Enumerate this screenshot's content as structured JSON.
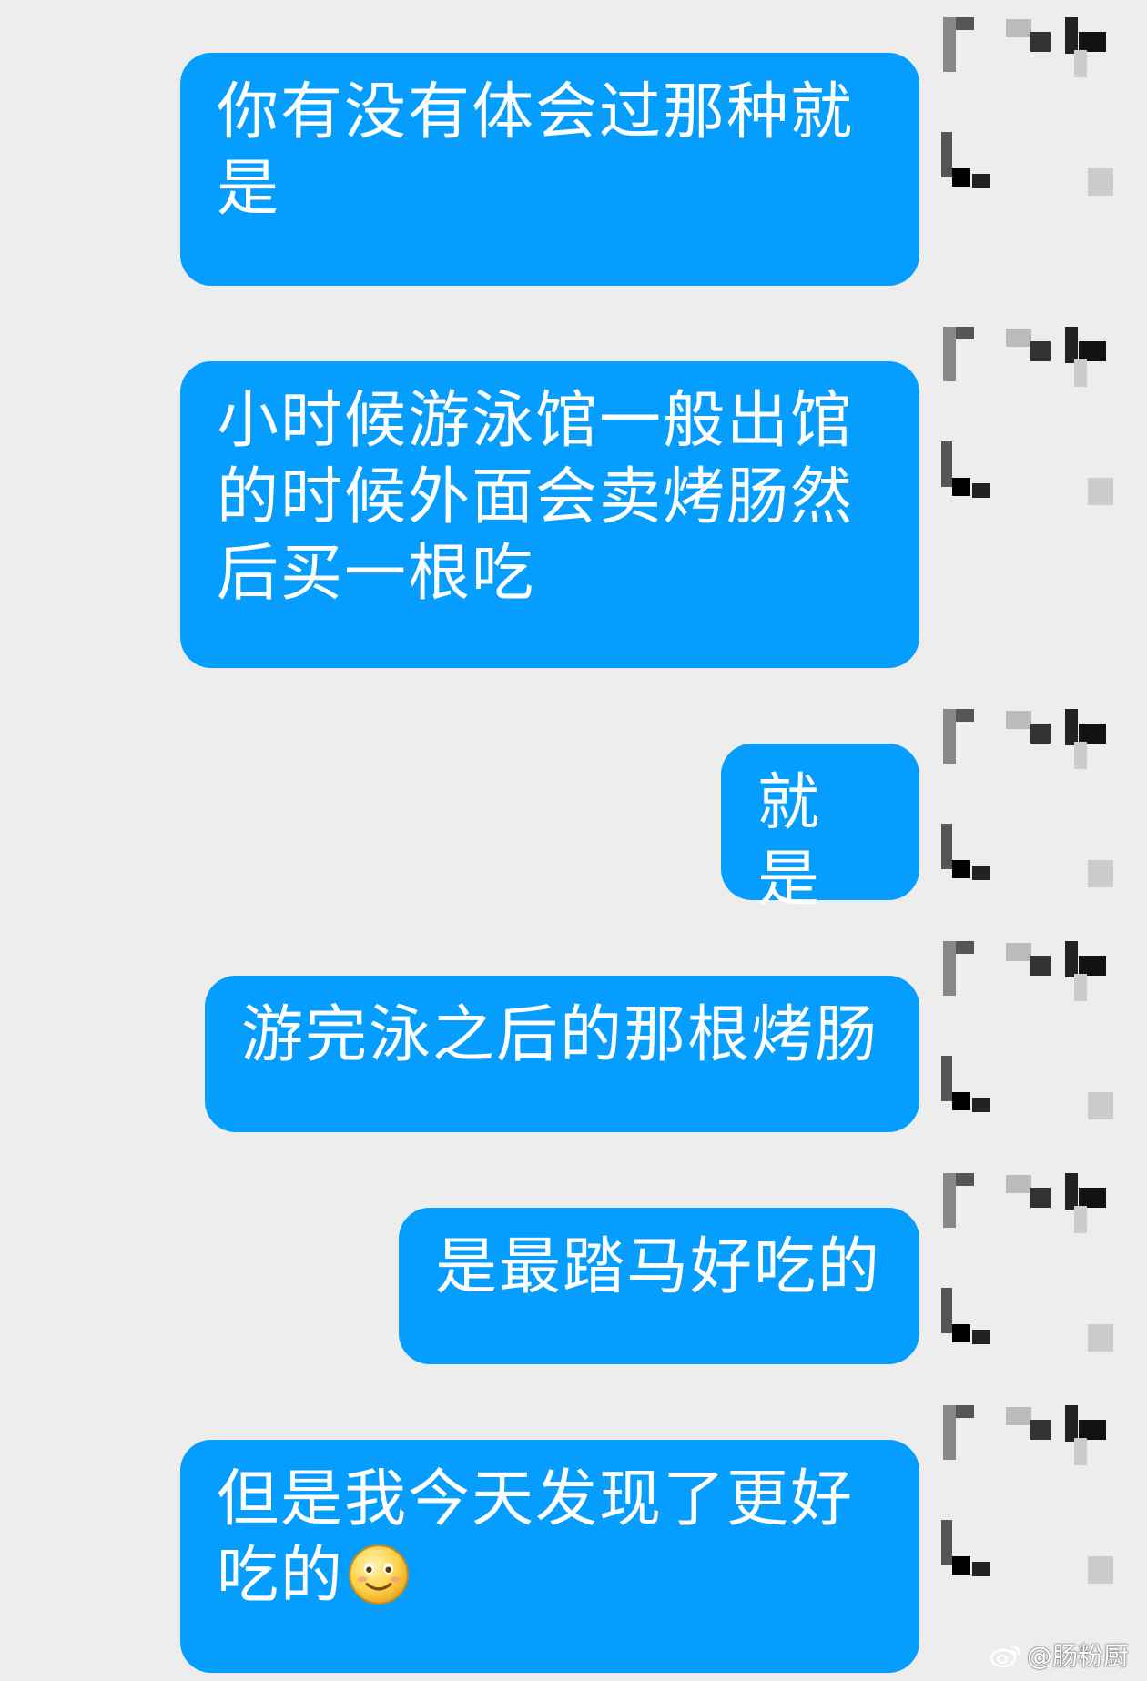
{
  "messages": [
    {
      "text": "你有没有体会过那种就是"
    },
    {
      "text": "小时候游泳馆一般出馆的时候外面会卖烤肠然后买一根吃"
    },
    {
      "text": "就是"
    },
    {
      "text": "游完泳之后的那根烤肠"
    },
    {
      "text": "是最踏马好吃的"
    },
    {
      "text": "但是我今天发现了更好吃的",
      "emoji": "smile-emoji"
    }
  ],
  "avatar_icon": "pixelated-avatar",
  "watermark": {
    "logo_icon": "weibo-logo-icon",
    "handle": "@肠粉厨"
  },
  "colors": {
    "background": "#ededed",
    "bubble": "#069efe",
    "bubble_text": "#ffffff"
  }
}
